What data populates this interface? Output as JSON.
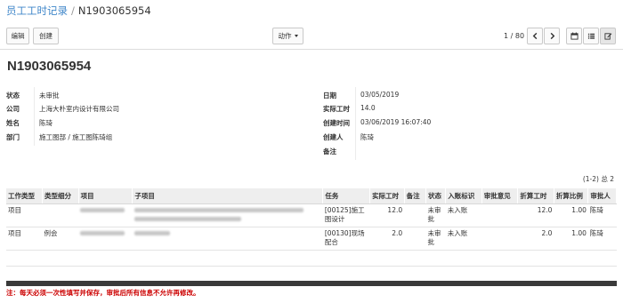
{
  "breadcrumb": {
    "parent": "员工工时记录",
    "separator": "/",
    "current": "N1903065954"
  },
  "toolbar": {
    "edit_label": "编辑",
    "create_label": "创建",
    "action_label": "动作",
    "pager": "1 / 80",
    "icons": [
      "chevron-left-icon",
      "chevron-right-icon",
      "calendar-icon",
      "list-icon",
      "form-edit-icon"
    ]
  },
  "record": {
    "title": "N1903065954",
    "left_fields": [
      {
        "label": "状态",
        "value": "未审批"
      },
      {
        "label": "公司",
        "value": "上海大朴室内设计有限公司"
      },
      {
        "label": "姓名",
        "value": "陈琦"
      },
      {
        "label": "部门",
        "value": "施工图部 / 施工图陈琦组"
      }
    ],
    "right_fields": [
      {
        "label": "日期",
        "value": "03/05/2019"
      },
      {
        "label": "实际工时",
        "value": "14.0"
      },
      {
        "label": "创建时间",
        "value": "03/06/2019 16:07:40"
      },
      {
        "label": "创建人",
        "value": "陈琦"
      },
      {
        "label": "备注",
        "value": ""
      }
    ]
  },
  "lines": {
    "count": "(1-2) 总 2",
    "columns": [
      "工作类型",
      "类型细分",
      "项目",
      "子项目",
      "任务",
      "实际工时",
      "备注",
      "状态",
      "入账标识",
      "审批意见",
      "折算工时",
      "折算比例",
      "审批人"
    ],
    "rows": [
      {
        "type": "项目",
        "subtype": "",
        "task": "[00125]施工图设计",
        "hours": "12.0",
        "remark": "",
        "status": "未审批",
        "booked": "未入账",
        "opinion": "",
        "conv_hours": "12.0",
        "ratio": "1.00",
        "approver": "陈琦"
      },
      {
        "type": "项目",
        "subtype": "例会",
        "task": "[00130]现场配合",
        "hours": "2.0",
        "remark": "",
        "status": "未审批",
        "booked": "未入账",
        "opinion": "",
        "conv_hours": "2.0",
        "ratio": "1.00",
        "approver": "陈琦"
      }
    ]
  },
  "notice": "注：每天必须一次性填写并保存，审批后所有信息不允许再修改。"
}
